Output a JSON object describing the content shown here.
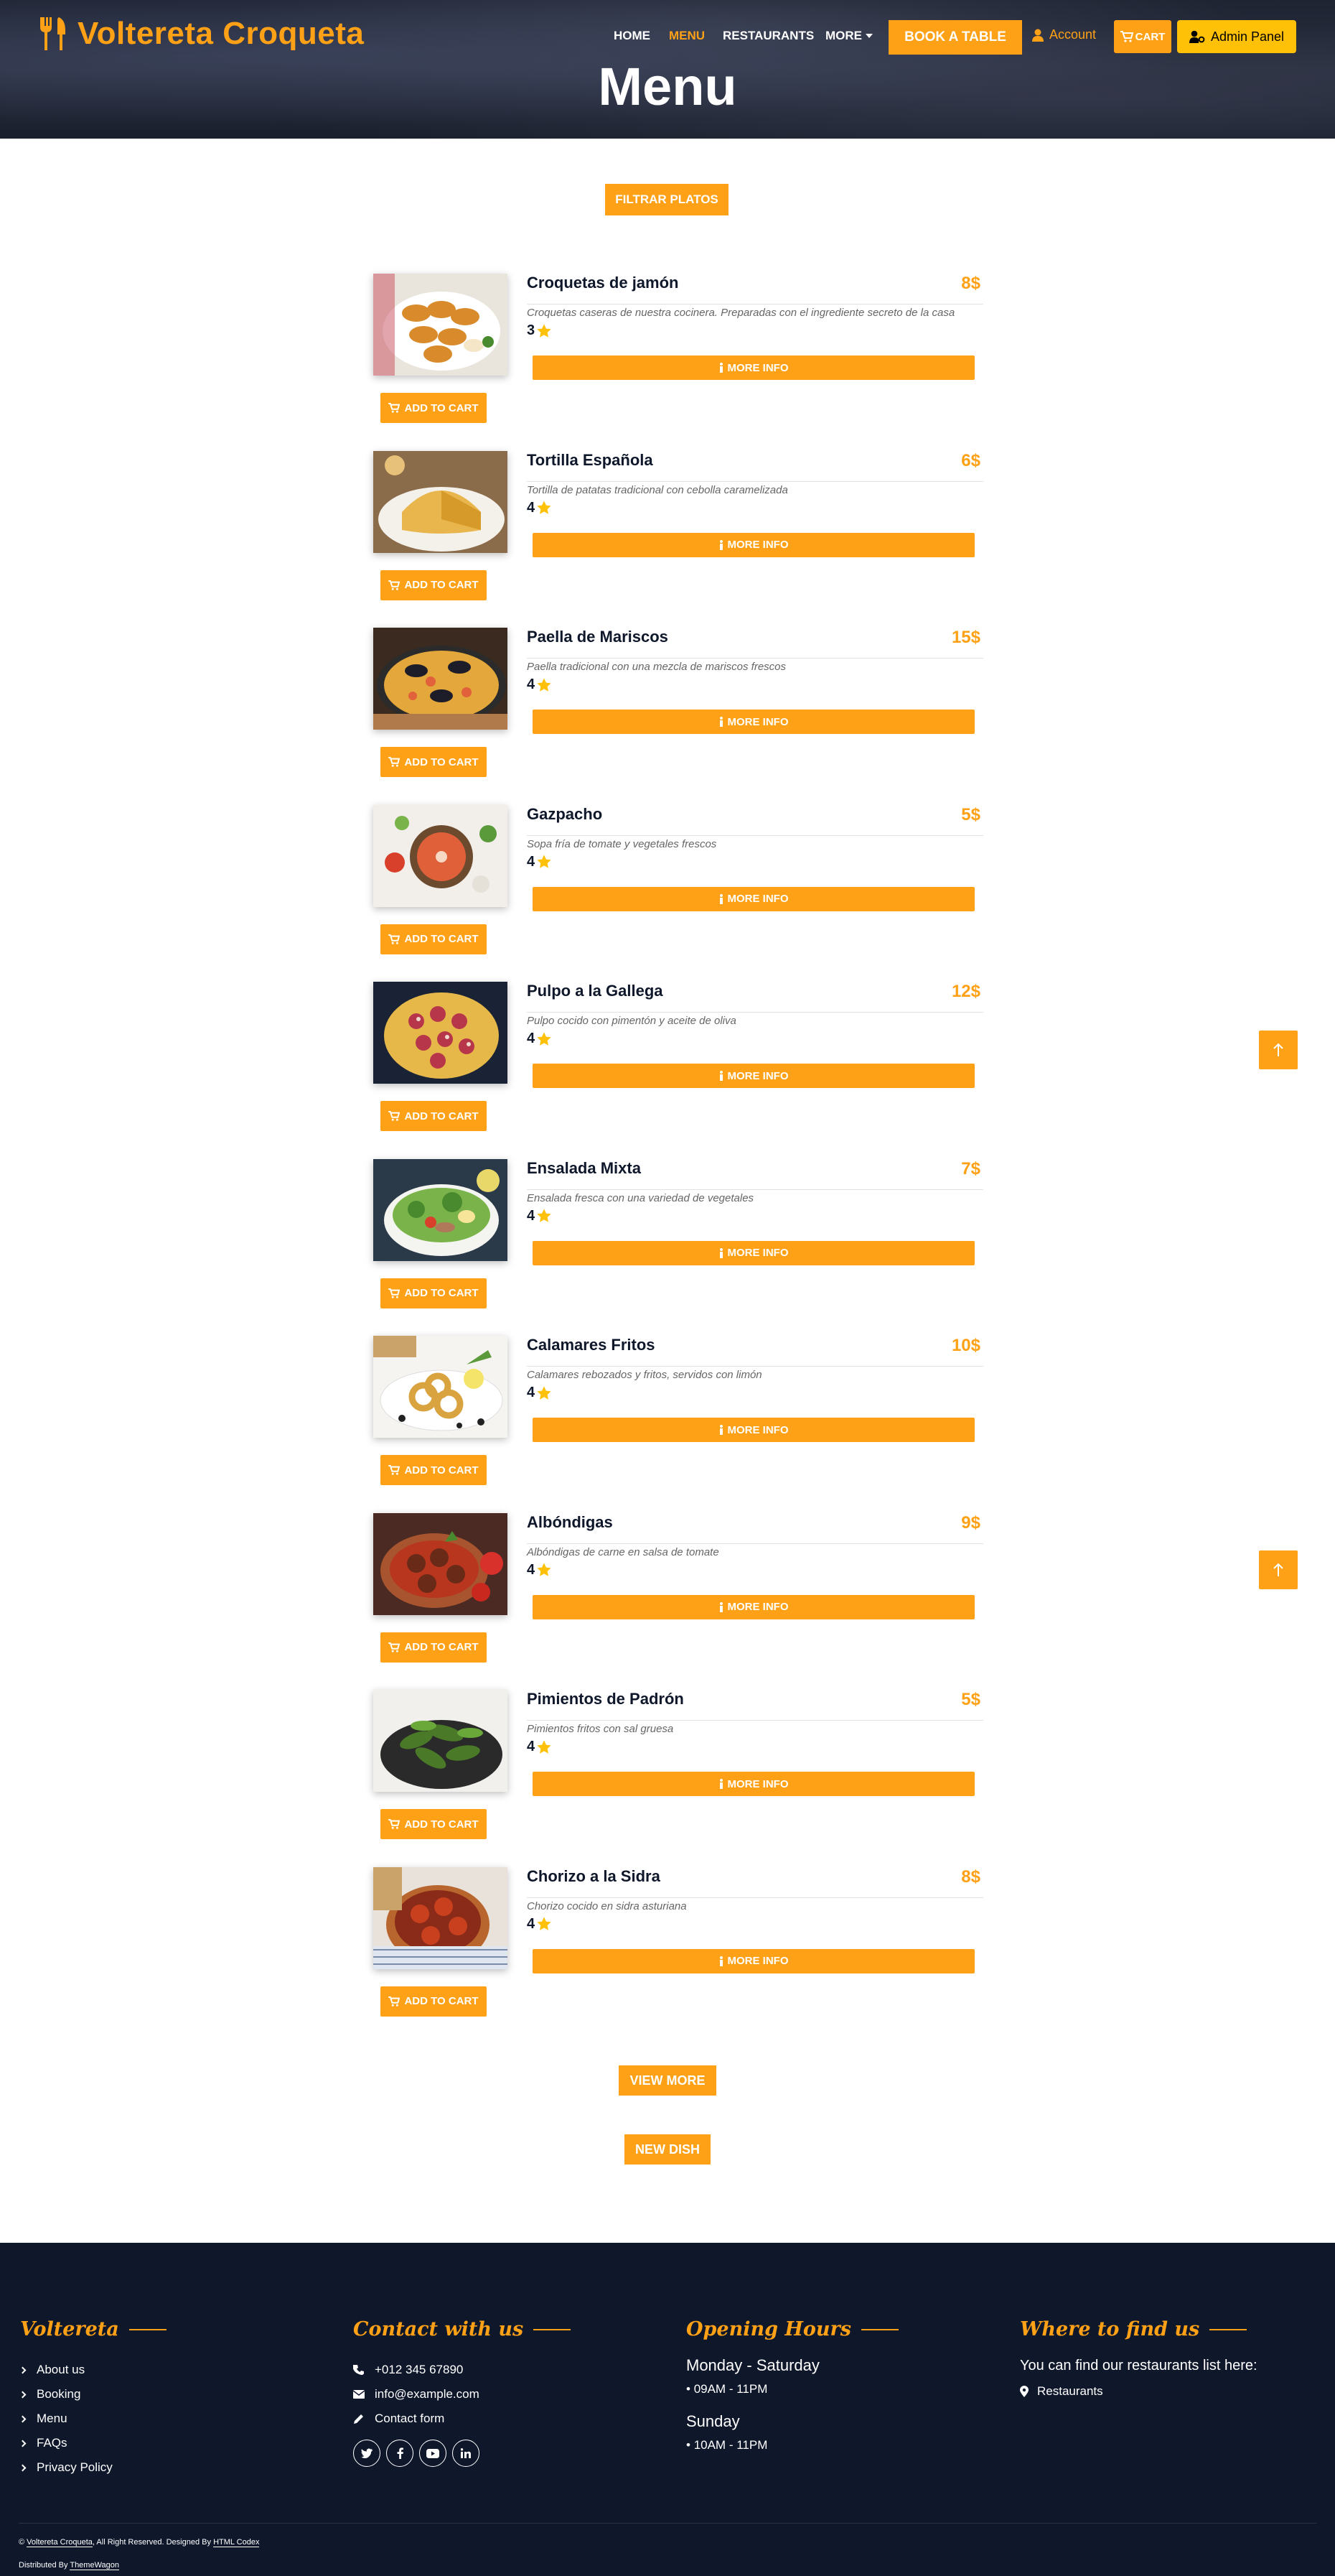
{
  "header": {
    "brand": "Voltereta Croqueta",
    "nav": [
      "HOME",
      "MENU",
      "RESTAURANTS",
      "MORE"
    ],
    "active_nav": "MENU",
    "book_label": "BOOK A TABLE",
    "account_label": "Account",
    "cart_label": "CART",
    "admin_label": "Admin Panel",
    "page_title": "Menu"
  },
  "filter_label": "FILTRAR PLATOS",
  "item_buttons": {
    "more_info": "MORE INFO",
    "add_to_cart": "ADD TO CART"
  },
  "items": [
    {
      "name": "Croquetas de jamón",
      "price": "8$",
      "desc": "Croquetas caseras de nuestra cocinera. Preparadas con el ingrediente secreto de la casa",
      "rating": "3",
      "image": "croquetas"
    },
    {
      "name": "Tortilla Española",
      "price": "6$",
      "desc": "Tortilla de patatas tradicional con cebolla caramelizada",
      "rating": "4",
      "image": "tortilla"
    },
    {
      "name": "Paella de Mariscos",
      "price": "15$",
      "desc": "Paella tradicional con una mezcla de mariscos frescos",
      "rating": "4",
      "image": "paella"
    },
    {
      "name": "Gazpacho",
      "price": "5$",
      "desc": "Sopa fría de tomate y vegetales frescos",
      "rating": "4",
      "image": "gazpacho"
    },
    {
      "name": "Pulpo a la Gallega",
      "price": "12$",
      "desc": "Pulpo cocido con pimentón y aceite de oliva",
      "rating": "4",
      "image": "pulpo"
    },
    {
      "name": "Ensalada Mixta",
      "price": "7$",
      "desc": "Ensalada fresca con una variedad de vegetales",
      "rating": "4",
      "image": "ensalada"
    },
    {
      "name": "Calamares Fritos",
      "price": "10$",
      "desc": "Calamares rebozados y fritos, servidos con limón",
      "rating": "4",
      "image": "calamares"
    },
    {
      "name": "Albóndigas",
      "price": "9$",
      "desc": "Albóndigas de carne en salsa de tomate",
      "rating": "4",
      "image": "albondigas"
    },
    {
      "name": "Pimientos de Padrón",
      "price": "5$",
      "desc": "Pimientos fritos con sal gruesa",
      "rating": "4",
      "image": "pimientos"
    },
    {
      "name": "Chorizo a la Sidra",
      "price": "8$",
      "desc": "Chorizo cocido en sidra asturiana",
      "rating": "4",
      "image": "chorizo"
    }
  ],
  "view_more_label": "VIEW MORE",
  "new_dish_label": "NEW DISH",
  "footer": {
    "col1": {
      "title": "Voltereta",
      "links": [
        "About us",
        "Booking",
        "Menu",
        "FAQs",
        "Privacy Policy"
      ]
    },
    "col2": {
      "title": "Contact with us",
      "phone": "+012 345 67890",
      "email": "info@example.com",
      "form": "Contact form"
    },
    "col3": {
      "title": "Opening Hours",
      "day1": "Monday - Saturday",
      "hours1": "09AM - 11PM",
      "day2": "Sunday",
      "hours2": "10AM - 11PM"
    },
    "col4": {
      "title": "Where to find us",
      "text": "You can find our restaurants list here:",
      "link": "Restaurants"
    },
    "copyright_brand": "Voltereta Croqueta",
    "copyright_rest": ", All Right Reserved. Designed By",
    "designer": "HTML Codex",
    "distributed_prefix": "Distributed By",
    "distributor": "ThemeWagon"
  },
  "colors": {
    "accent": "#fea116",
    "dark": "#0f172b",
    "admin": "#ffc107"
  }
}
